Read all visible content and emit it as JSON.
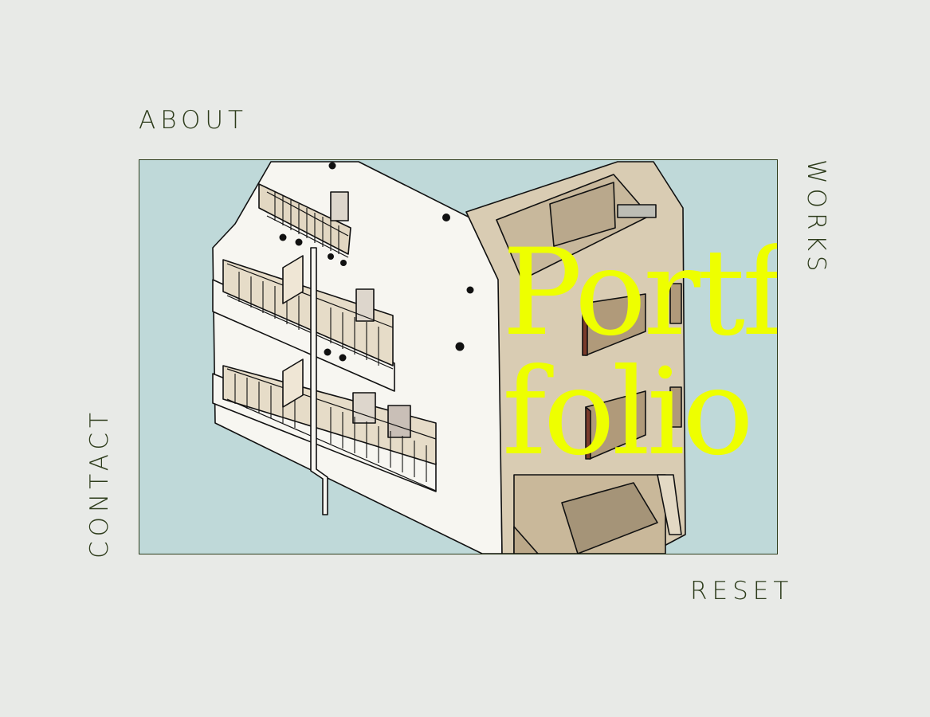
{
  "nav": {
    "about": "ABOUT",
    "works": "WORKS",
    "contact": "CONTACT",
    "reset": "RESET"
  },
  "hero": {
    "title_line1": "Portfolio",
    "title_line2": "folio",
    "illustration": "isometric-apartment-building"
  },
  "colors": {
    "background": "#e8eae7",
    "text": "#2e3d1c",
    "frame_fill": "#bfd9d9",
    "title": "#eeff00",
    "wall_white": "#f7f6f1",
    "wall_beige": "#d9ccb3",
    "window_frame": "#7a3a2a"
  }
}
